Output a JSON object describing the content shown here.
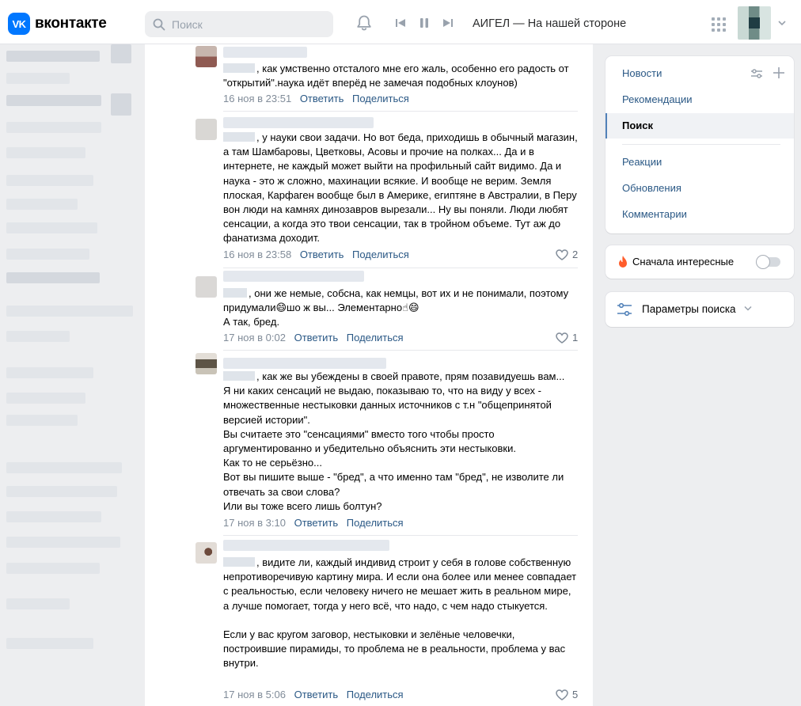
{
  "header": {
    "logo_text": "вконтакте",
    "logo_badge": "VK",
    "search_placeholder": "Поиск",
    "now_playing": "АИГЕЛ — На нашей стороне"
  },
  "comments": [
    {
      "text": ", как умственно отсталого мне его жаль, особенно его радость от \"открытий\".наука идёт вперёд не замечая подобных клоунов)",
      "time": "16 ноя в 23:51",
      "reply": "Ответить",
      "share": "Поделиться",
      "likes": ""
    },
    {
      "text": ", у науки свои задачи. Но вот беда, приходишь в обычный магазин, а там Шамбаровы, Цветковы, Асовы и прочие на полках... Да и в интернете, не каждый может выйти на профильный сайт видимо. Да и наука - это ж сложно, махинации всякие. И вообще не верим. Земля плоская, Карфаген вообще был в Америке, египтяне в Австралии, в Перу вон люди на камнях динозавров вырезали... Ну вы поняли. Люди любят сенсации, а когда это твои сенсации, так в тройном объеме. Тут аж до фанатизма доходит.",
      "time": "16 ноя в 23:58",
      "reply": "Ответить",
      "share": "Поделиться",
      "likes": "2"
    },
    {
      "text": ", они же немые, собсна, как немцы, вот их и не понимали, поэтому придумали😄шо ж вы... Элементарно☝😄\nА так, бред.",
      "time": "17 ноя в 0:02",
      "reply": "Ответить",
      "share": "Поделиться",
      "likes": "1"
    },
    {
      "text": ", как же вы убеждены в своей правоте, прям позавидуешь вам...\nЯ ни каких сенсаций не выдаю, показываю то, что на виду у всех - множественные нестыковки данных источников с т.н \"общепринятой версией истории\".\nВы считаете это \"сенсациями\" вместо того чтобы просто аргументированно и убедительно объяснить эти нестыковки.\nКак то не серьёзно...\nВот вы пишите выше - \"бред\", а что именно там \"бред\", не изволите ли отвечать за свои слова?\nИли вы тоже всего лишь болтун?",
      "time": "17 ноя в 3:10",
      "reply": "Ответить",
      "share": "Поделиться",
      "likes": ""
    },
    {
      "text": ", видите ли, каждый индивид строит у себя в голове собственную непротиворечивую картину мира. И если она более или менее совпадает с реальностью, если человеку ничего не мешает жить в реальном мире, а лучше помогает, тогда у него всё, что надо, с чем надо стыкуется.\n\nЕсли у вас кругом заговор, нестыковки и зелёные человечки, построившие пирамиды, то проблема не в реальности, проблема у вас внутри.",
      "time": "17 ноя в 5:06",
      "reply": "Ответить",
      "share": "Поделиться",
      "likes": "5"
    }
  ],
  "right_nav": {
    "items": [
      "Новости",
      "Рекомендации",
      "Поиск",
      "Реакции",
      "Обновления",
      "Комментарии"
    ],
    "active": "Поиск"
  },
  "sort_toggle": {
    "label": "Сначала интересные",
    "enabled": false
  },
  "search_params": {
    "label": "Параметры поиска"
  },
  "colors": {
    "accent": "#2a5885",
    "brand": "#0077ff",
    "bg": "#edeef0"
  }
}
